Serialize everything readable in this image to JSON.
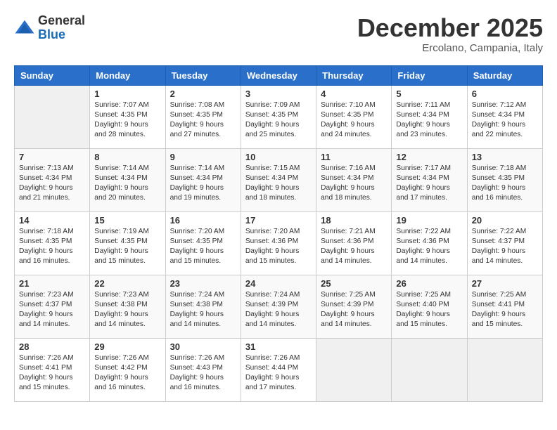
{
  "logo": {
    "general": "General",
    "blue": "Blue"
  },
  "title": {
    "month": "December 2025",
    "location": "Ercolano, Campania, Italy"
  },
  "weekdays": [
    "Sunday",
    "Monday",
    "Tuesday",
    "Wednesday",
    "Thursday",
    "Friday",
    "Saturday"
  ],
  "weeks": [
    [
      {
        "day": "",
        "info": ""
      },
      {
        "day": "1",
        "info": "Sunrise: 7:07 AM\nSunset: 4:35 PM\nDaylight: 9 hours\nand 28 minutes."
      },
      {
        "day": "2",
        "info": "Sunrise: 7:08 AM\nSunset: 4:35 PM\nDaylight: 9 hours\nand 27 minutes."
      },
      {
        "day": "3",
        "info": "Sunrise: 7:09 AM\nSunset: 4:35 PM\nDaylight: 9 hours\nand 25 minutes."
      },
      {
        "day": "4",
        "info": "Sunrise: 7:10 AM\nSunset: 4:35 PM\nDaylight: 9 hours\nand 24 minutes."
      },
      {
        "day": "5",
        "info": "Sunrise: 7:11 AM\nSunset: 4:34 PM\nDaylight: 9 hours\nand 23 minutes."
      },
      {
        "day": "6",
        "info": "Sunrise: 7:12 AM\nSunset: 4:34 PM\nDaylight: 9 hours\nand 22 minutes."
      }
    ],
    [
      {
        "day": "7",
        "info": "Sunrise: 7:13 AM\nSunset: 4:34 PM\nDaylight: 9 hours\nand 21 minutes."
      },
      {
        "day": "8",
        "info": "Sunrise: 7:14 AM\nSunset: 4:34 PM\nDaylight: 9 hours\nand 20 minutes."
      },
      {
        "day": "9",
        "info": "Sunrise: 7:14 AM\nSunset: 4:34 PM\nDaylight: 9 hours\nand 19 minutes."
      },
      {
        "day": "10",
        "info": "Sunrise: 7:15 AM\nSunset: 4:34 PM\nDaylight: 9 hours\nand 18 minutes."
      },
      {
        "day": "11",
        "info": "Sunrise: 7:16 AM\nSunset: 4:34 PM\nDaylight: 9 hours\nand 18 minutes."
      },
      {
        "day": "12",
        "info": "Sunrise: 7:17 AM\nSunset: 4:34 PM\nDaylight: 9 hours\nand 17 minutes."
      },
      {
        "day": "13",
        "info": "Sunrise: 7:18 AM\nSunset: 4:35 PM\nDaylight: 9 hours\nand 16 minutes."
      }
    ],
    [
      {
        "day": "14",
        "info": "Sunrise: 7:18 AM\nSunset: 4:35 PM\nDaylight: 9 hours\nand 16 minutes."
      },
      {
        "day": "15",
        "info": "Sunrise: 7:19 AM\nSunset: 4:35 PM\nDaylight: 9 hours\nand 15 minutes."
      },
      {
        "day": "16",
        "info": "Sunrise: 7:20 AM\nSunset: 4:35 PM\nDaylight: 9 hours\nand 15 minutes."
      },
      {
        "day": "17",
        "info": "Sunrise: 7:20 AM\nSunset: 4:36 PM\nDaylight: 9 hours\nand 15 minutes."
      },
      {
        "day": "18",
        "info": "Sunrise: 7:21 AM\nSunset: 4:36 PM\nDaylight: 9 hours\nand 14 minutes."
      },
      {
        "day": "19",
        "info": "Sunrise: 7:22 AM\nSunset: 4:36 PM\nDaylight: 9 hours\nand 14 minutes."
      },
      {
        "day": "20",
        "info": "Sunrise: 7:22 AM\nSunset: 4:37 PM\nDaylight: 9 hours\nand 14 minutes."
      }
    ],
    [
      {
        "day": "21",
        "info": "Sunrise: 7:23 AM\nSunset: 4:37 PM\nDaylight: 9 hours\nand 14 minutes."
      },
      {
        "day": "22",
        "info": "Sunrise: 7:23 AM\nSunset: 4:38 PM\nDaylight: 9 hours\nand 14 minutes."
      },
      {
        "day": "23",
        "info": "Sunrise: 7:24 AM\nSunset: 4:38 PM\nDaylight: 9 hours\nand 14 minutes."
      },
      {
        "day": "24",
        "info": "Sunrise: 7:24 AM\nSunset: 4:39 PM\nDaylight: 9 hours\nand 14 minutes."
      },
      {
        "day": "25",
        "info": "Sunrise: 7:25 AM\nSunset: 4:39 PM\nDaylight: 9 hours\nand 14 minutes."
      },
      {
        "day": "26",
        "info": "Sunrise: 7:25 AM\nSunset: 4:40 PM\nDaylight: 9 hours\nand 15 minutes."
      },
      {
        "day": "27",
        "info": "Sunrise: 7:25 AM\nSunset: 4:41 PM\nDaylight: 9 hours\nand 15 minutes."
      }
    ],
    [
      {
        "day": "28",
        "info": "Sunrise: 7:26 AM\nSunset: 4:41 PM\nDaylight: 9 hours\nand 15 minutes."
      },
      {
        "day": "29",
        "info": "Sunrise: 7:26 AM\nSunset: 4:42 PM\nDaylight: 9 hours\nand 16 minutes."
      },
      {
        "day": "30",
        "info": "Sunrise: 7:26 AM\nSunset: 4:43 PM\nDaylight: 9 hours\nand 16 minutes."
      },
      {
        "day": "31",
        "info": "Sunrise: 7:26 AM\nSunset: 4:44 PM\nDaylight: 9 hours\nand 17 minutes."
      },
      {
        "day": "",
        "info": ""
      },
      {
        "day": "",
        "info": ""
      },
      {
        "day": "",
        "info": ""
      }
    ]
  ]
}
